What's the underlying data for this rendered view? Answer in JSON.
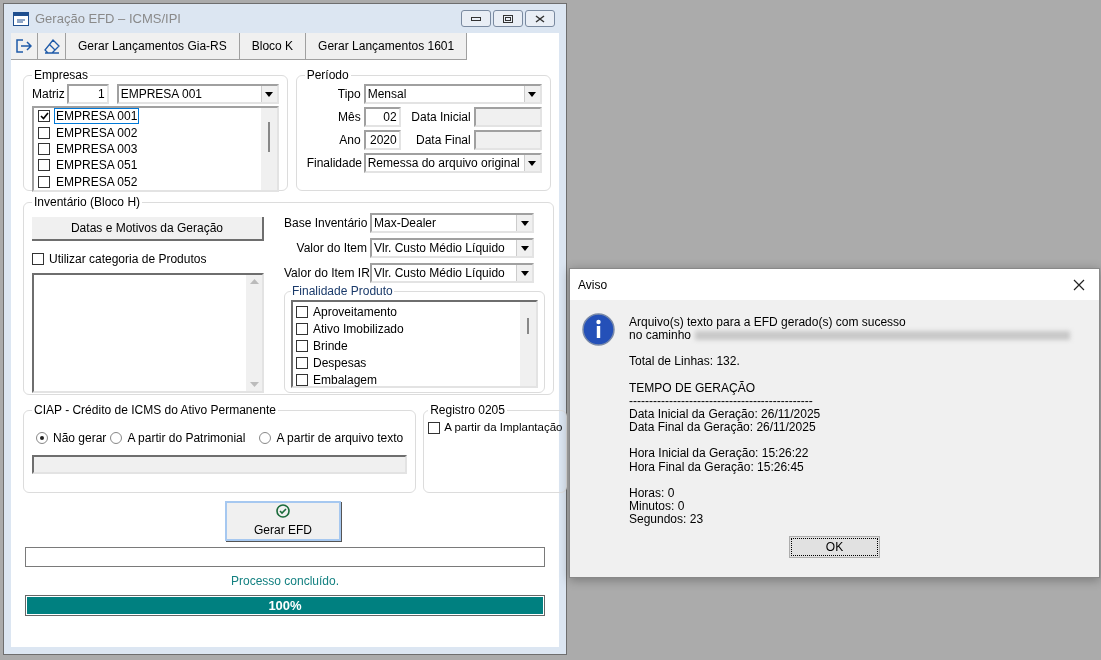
{
  "main_window": {
    "title": "Geração EFD – ICMS/IPI",
    "toolbar": [
      {
        "label": "Gerar Lançamentos Gia-RS"
      },
      {
        "label": "Bloco K"
      },
      {
        "label": "Gerar Lançamentos 1601"
      }
    ],
    "empresas": {
      "title": "Empresas",
      "matriz_label": "Matriz",
      "matriz_value": "1",
      "company": "EMPRESA 001",
      "companies": [
        {
          "label": "EMPRESA 001",
          "checked": true,
          "selected": true
        },
        {
          "label": "EMPRESA 002",
          "checked": false,
          "selected": false
        },
        {
          "label": "EMPRESA 003",
          "checked": false,
          "selected": false
        },
        {
          "label": "EMPRESA 051",
          "checked": false,
          "selected": false
        },
        {
          "label": "EMPRESA 052",
          "checked": false,
          "selected": false
        }
      ]
    },
    "periodo": {
      "title": "Período",
      "tipo_label": "Tipo",
      "tipo": "Mensal",
      "mes_label": "Mês",
      "mes": "02",
      "ano_label": "Ano",
      "ano": "2020",
      "data_inicial_label": "Data Inicial",
      "data_final_label": "Data Final",
      "finalidade_label": "Finalidade",
      "finalidade": "Remessa do arquivo original"
    },
    "inventario": {
      "title": "Inventário (Bloco H)",
      "dates_button": "Datas e Motivos da Geração",
      "categoria": {
        "label": "Utilizar categoria de Produtos",
        "checked": false
      },
      "base_label": "Base Inventário",
      "base": "Max-Dealer",
      "valor_label": "Valor do Item",
      "valor": "Vlr. Custo Médio Líquido",
      "valor_ir_label": "Valor do Item IR",
      "valor_ir": "Vlr. Custo Médio Líquido",
      "finalidade_title": "Finalidade Produto",
      "finalidades": [
        {
          "label": "Aproveitamento",
          "checked": false
        },
        {
          "label": "Ativo Imobilizado",
          "checked": false
        },
        {
          "label": "Brinde",
          "checked": false
        },
        {
          "label": "Despesas",
          "checked": false
        },
        {
          "label": "Embalagem",
          "checked": false
        }
      ]
    },
    "ciap": {
      "title": "CIAP - Crédito de ICMS do Ativo Permanente",
      "options": [
        {
          "label": "Não gerar",
          "selected": true
        },
        {
          "label": "A partir do Patrimonial",
          "selected": false
        },
        {
          "label": "A partir de arquivo texto",
          "selected": false
        }
      ]
    },
    "registro": {
      "title": "Registro 0205",
      "option": {
        "label": "A partir da Implantação",
        "checked": false
      }
    },
    "generate_button": "Gerar EFD",
    "status": "Processo concluído.",
    "progress": {
      "level": 1,
      "label": "100%"
    }
  },
  "dialog": {
    "title": "Aviso",
    "message": "Arquivo(s) texto para a EFD gerado(s) com sucesso",
    "path_label": "no caminho",
    "sections": [
      [
        "Total de Linhas: 132."
      ],
      [
        "TEMPO DE GERAÇÃO",
        "----------------------------------------------",
        "Data Inicial da Geração: 26/11/2025",
        "Data Final da Geração: 26/11/2025"
      ],
      [
        "Hora Inicial da Geração: 15:26:22",
        "Hora Final da Geração: 15:26:45"
      ],
      [
        "Horas: 0",
        "Minutos: 0",
        "Segundos: 23"
      ]
    ],
    "ok_button": "OK"
  }
}
